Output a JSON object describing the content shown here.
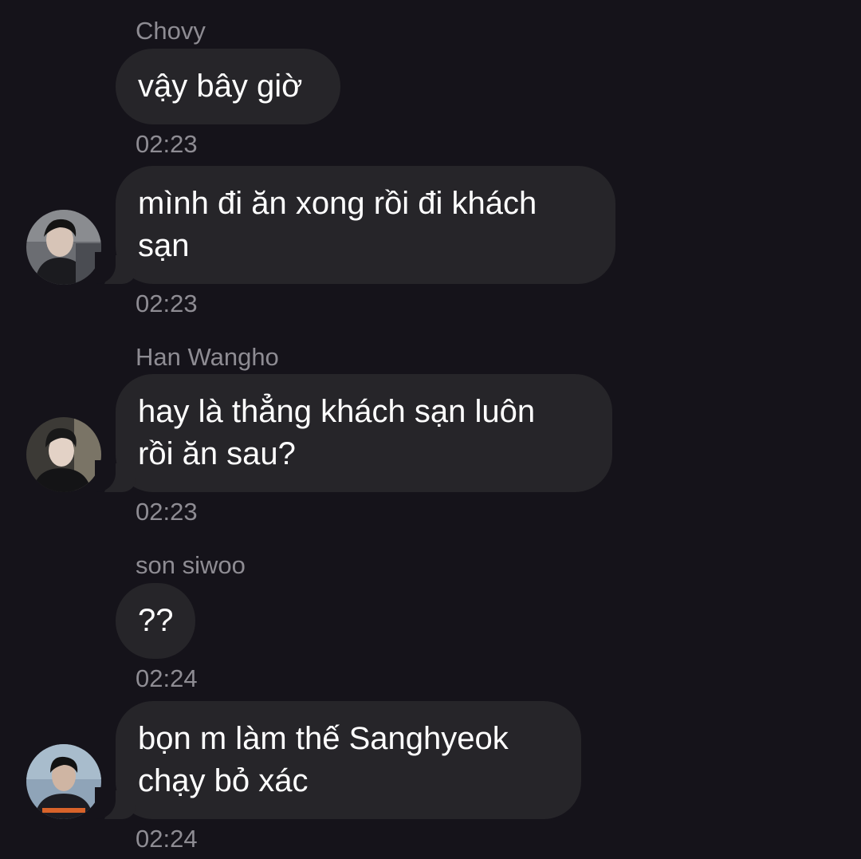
{
  "messages": [
    {
      "sender": "Chovy",
      "lines": [
        "vậy bây giờ"
      ],
      "time": "02:23"
    },
    {
      "sender": "",
      "lines": [
        "mình đi ăn xong rồi đi khách",
        "sạn"
      ],
      "time": "02:23",
      "avatar": "profile-photo"
    },
    {
      "sender": "Han Wangho",
      "lines": [
        "hay là thẳng khách sạn luôn",
        "rồi ăn sau?"
      ],
      "time": "02:23",
      "avatar": "profile-photo"
    },
    {
      "sender": "son siwoo",
      "lines": [
        "??"
      ],
      "time": "02:24"
    },
    {
      "sender": "",
      "lines": [
        "bọn m làm thế Sanghyeok",
        "chạy bỏ xác"
      ],
      "time": "02:24",
      "avatar": "profile-photo"
    }
  ],
  "colors": {
    "background": "#15131a",
    "bubble": "#262529",
    "secondary_text": "#8e8c93",
    "message_text": "#ffffff"
  }
}
